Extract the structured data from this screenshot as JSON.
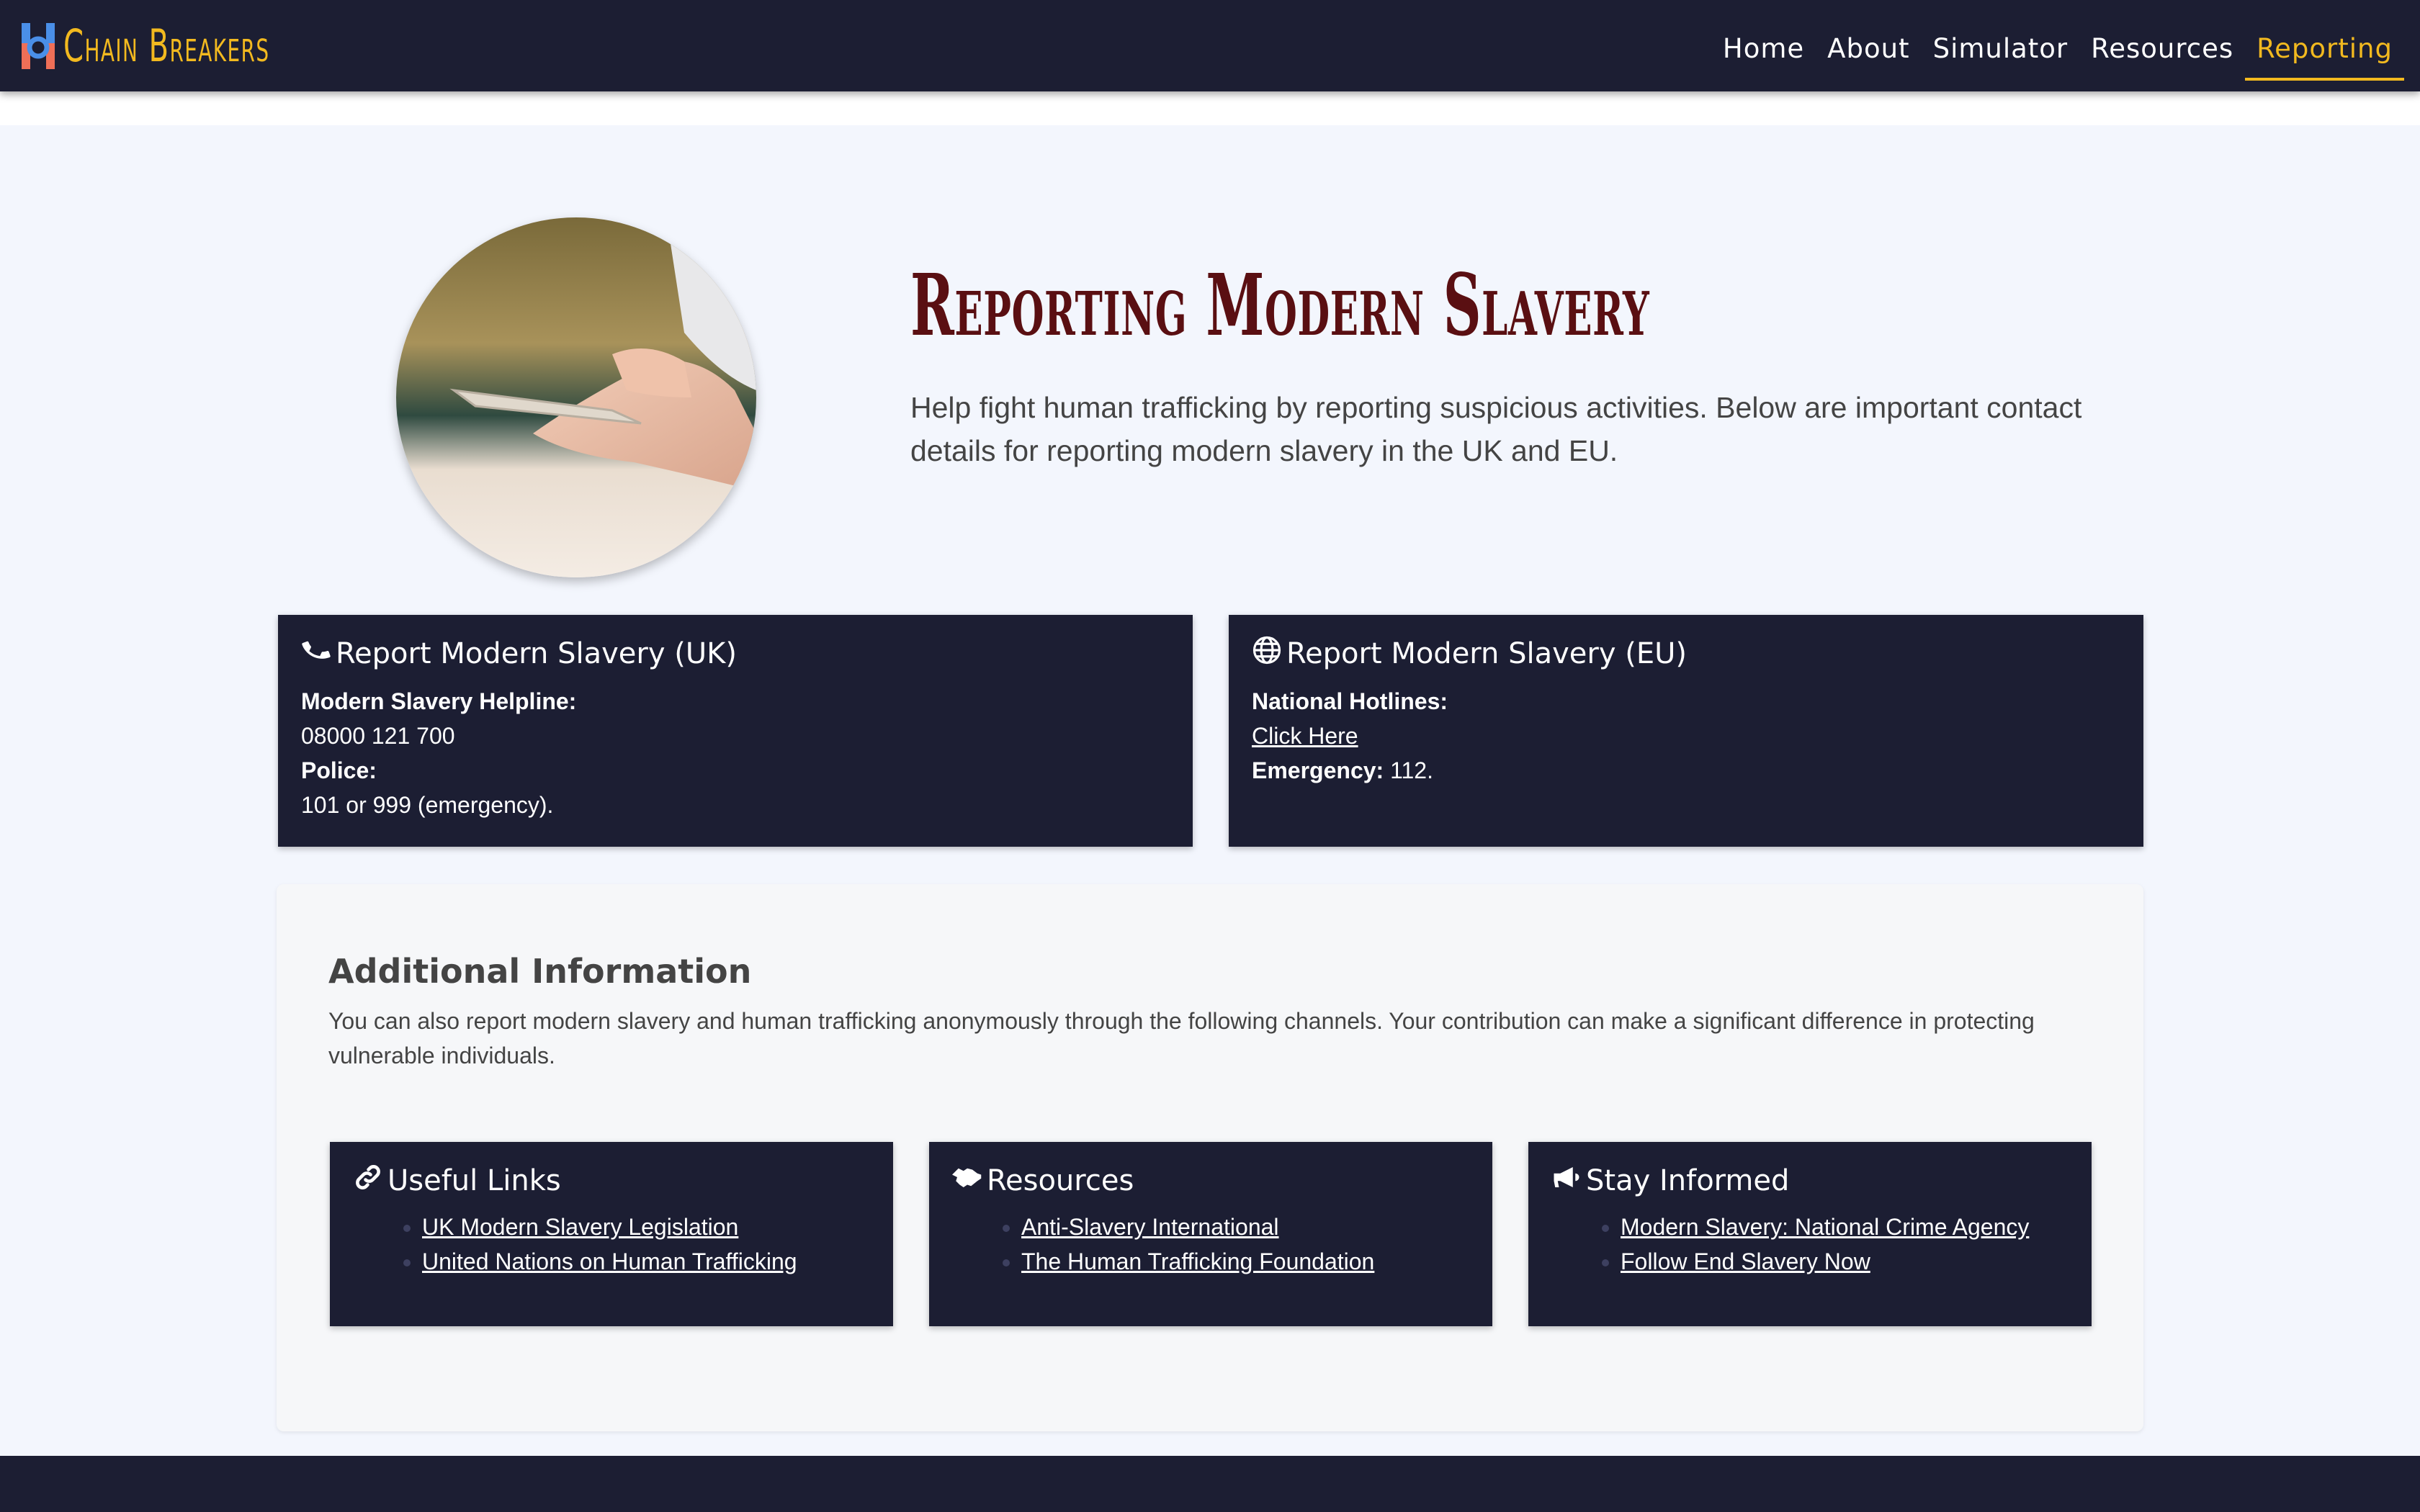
{
  "navbar": {
    "brand": "Chain Breakers",
    "links": [
      "Home",
      "About",
      "Simulator",
      "Resources",
      "Reporting"
    ],
    "active": "Reporting"
  },
  "hero": {
    "title": "Reporting Modern Slavery",
    "text": "Help fight human trafficking by reporting suspicious activities. Below are important contact details for reporting modern slavery in the UK and EU."
  },
  "uk_card": {
    "icon": "phone-icon",
    "title": "Report Modern Slavery (UK)",
    "helpline_label": "Modern Slavery Helpline:",
    "helpline_value": "08000 121 700",
    "police_label": "Police:",
    "police_value": "101 or 999 (emergency)."
  },
  "eu_card": {
    "icon": "globe-icon",
    "title": "Report Modern Slavery (EU)",
    "hotlines_label": "National Hotlines:",
    "hotlines_link": "Click Here",
    "emergency_label": "Emergency:",
    "emergency_value": "112."
  },
  "additional": {
    "heading": "Additional Information",
    "text": "You can also report modern slavery and human trafficking anonymously through the following channels. Your contribution can make a significant difference in protecting vulnerable individuals.",
    "cards": [
      {
        "icon": "link-icon",
        "title": "Useful Links",
        "links": [
          "UK Modern Slavery Legislation",
          "United Nations on Human Trafficking"
        ]
      },
      {
        "icon": "handshake-icon",
        "title": "Resources",
        "links": [
          "Anti-Slavery International",
          "The Human Trafficking Foundation"
        ]
      },
      {
        "icon": "megaphone-icon",
        "title": "Stay Informed",
        "links": [
          "Modern Slavery: National Crime Agency",
          "Follow End Slavery Now"
        ]
      }
    ]
  },
  "colors": {
    "navy": "#1c1e33",
    "gold": "#f2b91f",
    "title_maroon": "#5a0f12",
    "page_bg": "#f3f6fd"
  }
}
